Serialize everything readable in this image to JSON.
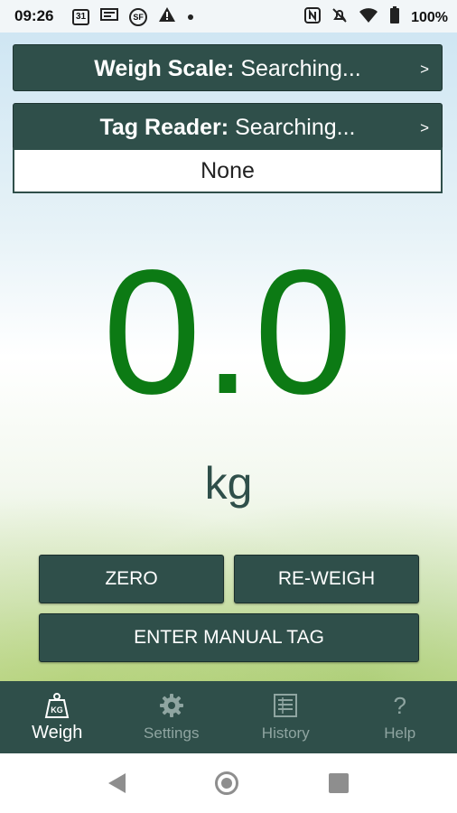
{
  "status_bar": {
    "time": "09:26",
    "left_icons": [
      "calendar-icon",
      "mail-icon",
      "sf-icon",
      "warning-icon",
      "dot-icon"
    ],
    "calendar_text": "31",
    "sf_text": "SF",
    "right_icons": [
      "nfc-icon",
      "mute-icon",
      "wifi-icon",
      "battery-icon"
    ],
    "battery_percent": "100%"
  },
  "scale": {
    "label": "Weigh Scale:",
    "status": "Searching...",
    "chevron": ">"
  },
  "tag_reader": {
    "label": "Tag Reader:",
    "status": "Searching...",
    "chevron": ">",
    "value": "None"
  },
  "weight": {
    "value": "0.0",
    "unit": "kg"
  },
  "buttons": {
    "zero": "ZERO",
    "reweigh": "RE-WEIGH",
    "manual_tag": "ENTER MANUAL TAG"
  },
  "bottom_nav": {
    "items": [
      {
        "label": "Weigh",
        "icon": "kg-weight-icon",
        "active": true
      },
      {
        "label": "Settings",
        "icon": "gear-icon",
        "active": false
      },
      {
        "label": "History",
        "icon": "list-icon",
        "active": false
      },
      {
        "label": "Help",
        "icon": "question-icon",
        "active": false
      }
    ]
  },
  "colors": {
    "primary": "#2f4f4a",
    "weight_text": "#0c7a14",
    "inactive_nav": "#8fa5a1"
  }
}
